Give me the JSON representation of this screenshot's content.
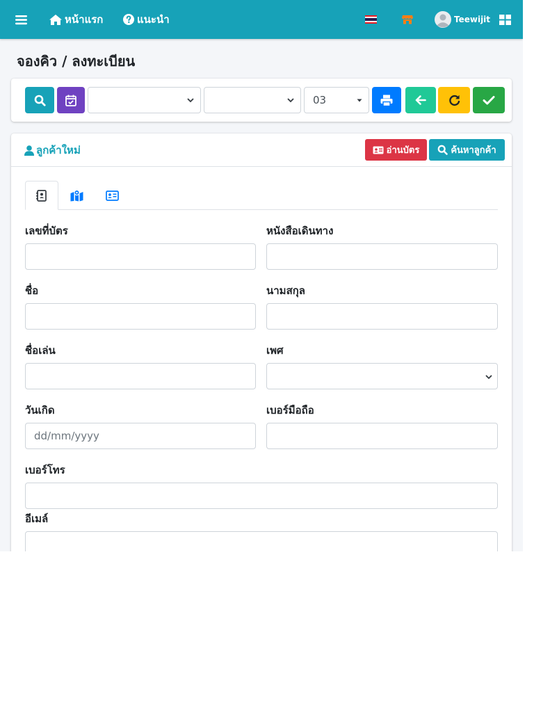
{
  "navbar": {
    "home_label": "หน้าแรก",
    "guide_label": "แนะนำ",
    "user_name": "Teewijit"
  },
  "page": {
    "title": "จองคิว / ลงทะเบียน"
  },
  "toolbar": {
    "select1_value": "",
    "select2_value": "",
    "select3_value": "03",
    "colors": {
      "search": "#17a2b8",
      "calendar": "#6f42c1",
      "print": "#007bff",
      "back": "#20c997",
      "refresh": "#ffc107",
      "confirm": "#28a745"
    }
  },
  "card": {
    "title": "ลูกค้าใหม่",
    "read_card_label": "อ่านบัตร",
    "search_customer_label": "ค้นหาลูกค้า"
  },
  "tabs": [
    {
      "icon": "contact-book-icon",
      "active": true
    },
    {
      "icon": "map-icon",
      "active": false
    },
    {
      "icon": "id-card-icon",
      "active": false
    }
  ],
  "form": {
    "id_card_label": "เลขที่บัตร",
    "passport_label": "หนังสือเดินทาง",
    "first_name_label": "ชื่อ",
    "last_name_label": "นามสกุล",
    "nickname_label": "ชื่อเล่น",
    "gender_label": "เพศ",
    "birthday_label": "วันเกิด",
    "birthday_placeholder": "dd/mm/yyyy",
    "mobile_label": "เบอร์มือถือ",
    "phone_label": "เบอร์โทร",
    "email_label": "อีเมล์"
  }
}
